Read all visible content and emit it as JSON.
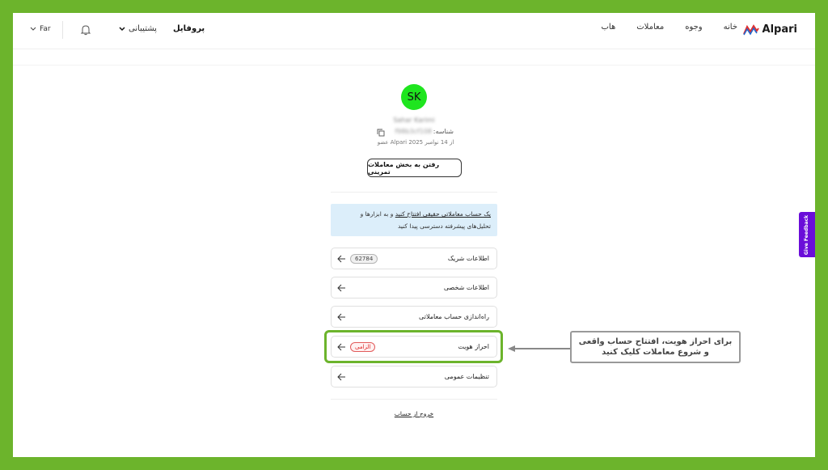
{
  "header": {
    "brand": "Alpari",
    "nav": [
      "خانه",
      "وجوه",
      "معاملات",
      "هاب"
    ],
    "profile": "پروفایل",
    "support": "پشتیبانی",
    "language": "Far"
  },
  "profile": {
    "avatar_initials": "SK",
    "name": "Sahar Karimi",
    "id_label": "شناسه:",
    "id_value": "f98b3cf108",
    "member_since": "عضو Alpari از 14 نوامبر 2025",
    "demo_button": "رفتن به بخش معاملات تمرینی"
  },
  "banner": {
    "link": "یک حساب معاملاتی حقیقی افتتاح کنید",
    "text": "و به ابزارها و تحلیل‌های پیشرفته دسترسی پیدا کنید"
  },
  "menu": [
    {
      "label": "اطلاعات شریک",
      "badge": "62784"
    },
    {
      "label": "اطلاعات شخصی",
      "badge": ""
    },
    {
      "label": "راه‌اندازی حساب معاملاتی",
      "badge": ""
    },
    {
      "label": "احراز هویت",
      "badge": "الزامی"
    },
    {
      "label": "تنظیمات عمومی",
      "badge": ""
    }
  ],
  "logout": "خروج از حساب",
  "annotation": {
    "line1": "برای احراز هویت، افتتاح حساب واقعی",
    "line2": "و شروع معاملات کلیک کنید"
  },
  "feedback": "Give Feedback",
  "colors": {
    "frame": "#6cb42c",
    "avatar": "#1fe51f",
    "banner": "#dceefa",
    "feedback": "#6a0dd9",
    "required_badge": "#e25b5b"
  }
}
